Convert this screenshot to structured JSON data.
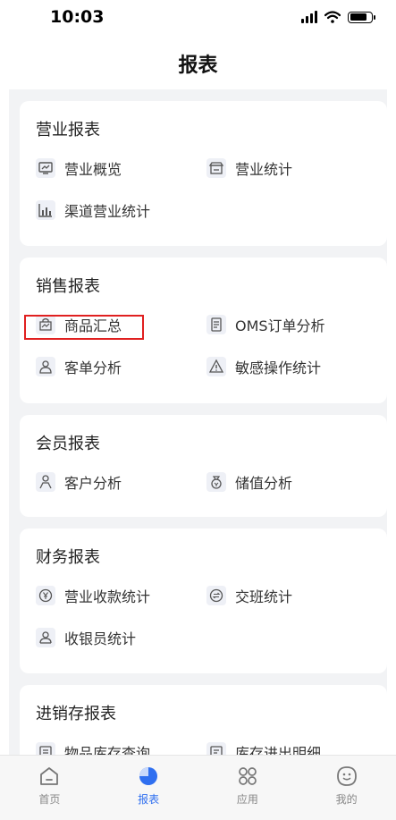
{
  "status": {
    "time": "10:03"
  },
  "page_title": "报表",
  "sections": [
    {
      "title": "营业报表",
      "items": [
        {
          "label": "营业概览",
          "icon": "monitor-chart-icon"
        },
        {
          "label": "营业统计",
          "icon": "store-icon"
        },
        {
          "label": "渠道营业统计",
          "icon": "bar-chart-icon"
        }
      ]
    },
    {
      "title": "销售报表",
      "items": [
        {
          "label": "商品汇总",
          "icon": "bag-chart-icon"
        },
        {
          "label": "OMS订单分析",
          "icon": "document-icon"
        },
        {
          "label": "客单分析",
          "icon": "person-icon"
        },
        {
          "label": "敏感操作统计",
          "icon": "warning-icon"
        }
      ]
    },
    {
      "title": "会员报表",
      "items": [
        {
          "label": "客户分析",
          "icon": "person-outline-icon"
        },
        {
          "label": "储值分析",
          "icon": "money-bag-icon"
        }
      ]
    },
    {
      "title": "财务报表",
      "items": [
        {
          "label": "营业收款统计",
          "icon": "yen-circle-icon"
        },
        {
          "label": "交班统计",
          "icon": "exchange-circle-icon"
        },
        {
          "label": "收银员统计",
          "icon": "cashier-icon"
        }
      ]
    },
    {
      "title": "进销存报表",
      "items": [
        {
          "label": "物品库存查询",
          "icon": "inventory-icon"
        },
        {
          "label": "库存进出明细",
          "icon": "inventory-detail-icon"
        }
      ]
    }
  ],
  "tabs": [
    {
      "label": "首页",
      "icon": "home-icon"
    },
    {
      "label": "报表",
      "icon": "pie-chart-icon",
      "active": true
    },
    {
      "label": "应用",
      "icon": "apps-icon"
    },
    {
      "label": "我的",
      "icon": "profile-icon"
    }
  ],
  "colors": {
    "accent": "#2f6ff0",
    "highlight": "#e02020",
    "background": "#f2f3f5"
  }
}
